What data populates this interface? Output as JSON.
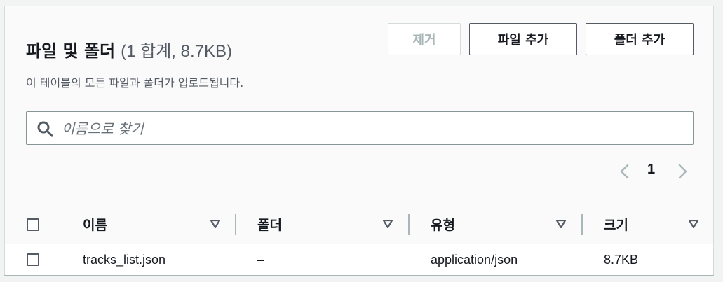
{
  "header": {
    "title": "파일 및 폴더",
    "counter": "(1 합계, 8.7KB)",
    "description": "이 테이블의 모든 파일과 폴더가 업로드됩니다."
  },
  "actions": {
    "remove_label": "제거",
    "add_files_label": "파일 추가",
    "add_folder_label": "폴더 추가"
  },
  "search": {
    "placeholder": "이름으로 찾기",
    "value": ""
  },
  "pagination": {
    "current_page": "1"
  },
  "table": {
    "columns": [
      "이름",
      "폴더",
      "유형",
      "크기"
    ],
    "rows": [
      {
        "name": "tracks_list.json",
        "folder": "–",
        "type": "application/json",
        "size": "8.7KB"
      }
    ]
  },
  "colors": {
    "text": "#16191f",
    "secondary_text": "#545b64",
    "disabled_text": "#aab7b8",
    "border": "#545b64",
    "panel_background": "#fafafa"
  },
  "icons": {
    "search": "search-icon",
    "prev": "chevron-left-icon",
    "next": "chevron-right-icon",
    "sort": "sort-down-icon"
  }
}
